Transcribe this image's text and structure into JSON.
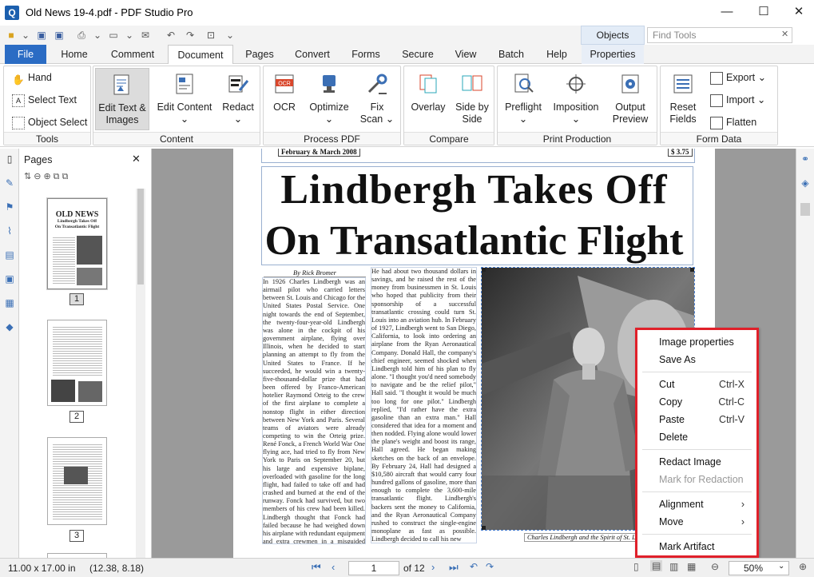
{
  "app": {
    "title": "Old News 19-4.pdf - PDF Studio Pro",
    "icon_letter": "Q",
    "window_buttons": [
      "—",
      "☐",
      "✕"
    ]
  },
  "quick_access": {
    "objects_tab": "Objects",
    "find_tools_placeholder": "Find Tools",
    "find_close": "✕"
  },
  "tabs": [
    {
      "label": "File"
    },
    {
      "label": "Home"
    },
    {
      "label": "Comment"
    },
    {
      "label": "Document"
    },
    {
      "label": "Pages"
    },
    {
      "label": "Convert"
    },
    {
      "label": "Forms"
    },
    {
      "label": "Secure"
    },
    {
      "label": "View"
    },
    {
      "label": "Batch"
    },
    {
      "label": "Help"
    },
    {
      "label": "Properties"
    }
  ],
  "ribbon": {
    "tools": {
      "label": "Tools",
      "hand": "Hand",
      "select_text": "Select Text",
      "object_select": "Object Select"
    },
    "content": {
      "label": "Content",
      "edit_text": "Edit Text &",
      "edit_text2": "Images",
      "edit_content": "Edit Content",
      "redact": "Redact"
    },
    "process": {
      "label": "Process PDF",
      "ocr": "OCR",
      "optimize": "Optimize",
      "fix": "Fix",
      "fix2": "Scan"
    },
    "compare": {
      "label": "Compare",
      "overlay": "Overlay",
      "side": "Side by",
      "side2": "Side"
    },
    "print": {
      "label": "Print Production",
      "preflight": "Preflight",
      "imposition": "Imposition",
      "output": "Output",
      "output2": "Preview"
    },
    "form": {
      "label": "Form Data",
      "reset": "Reset",
      "reset2": "Fields",
      "export": "Export",
      "import": "Import",
      "flatten": "Flatten"
    }
  },
  "pages_panel": {
    "title": "Pages",
    "close": "✕",
    "page_numbers": [
      "1",
      "2",
      "3"
    ],
    "thumb1_title": "OLD NEWS",
    "thumb1_sub1": "Lindbergh Takes Off",
    "thumb1_sub2": "On Transatlantic Flight"
  },
  "document": {
    "date": "February & March 2008",
    "price": "$ 3.75",
    "headline1": "Lindbergh Takes Off",
    "headline2": "On Transatlantic Flight",
    "byline": "By Rick Bromer",
    "col1": "In 1926 Charles Lindbergh was an airmail pilot who carried letters between St. Louis and Chicago for the United States Postal Service. One night towards the end of September, the twenty-four-year-old Lindbergh was alone in the cockpit of his government airplane, flying over Illinois, when he decided to start planning an attempt to fly from the United States to France. If he succeeded, he would win a twenty-five-thousand-dollar prize that had been offered by Franco-American hotelier Raymond Orteig to the crew of the first airplane to complete a nonstop flight in either direction between New York and Paris. Several teams of aviators were already competing to win the Orteig prize. René Fonck, a French World War One flying ace, had tried to fly from New York to Paris on September 20, but his large and expensive biplane, overloaded with gasoline for the long flight, had failed to take off and had crashed and burned at the end of the runway. Fonck had survived, but two members of his crew had been killed. Lindbergh thought that Fonck had failed because he had weighed down his airplane with redundant equipment and extra crewmen in a misguided attempt to make his flight safer. Fonck's plane had two sets of",
    "col2": "He had about two thousand dollars in savings, and he raised the rest of the money from businessmen in St. Louis who hoped that publicity from their sponsorship of a successful transatlantic crossing could turn St. Louis into an aviation hub. In February of 1927, Lindbergh went to San Diego, California, to look into ordering an airplane from the Ryan Aeronautical Company. Donald Hall, the company's chief engineer, seemed shocked when Lindbergh told him of his plan to fly alone. \"I thought you'd need somebody to navigate and be the relief pilot,\" Hall said. \"I thought it would be much too long for one pilot.\" Lindbergh replied, \"I'd rather have the extra gasoline than an extra man.\" Hall considered that idea for a moment and then nodded. Flying alone would lower the plane's weight and boost its range, Hall agreed. He began making sketches on the back of an envelope. By February 24, Hall had designed a $10,580 aircraft that would carry four hundred gallons of gasoline, more than enough to complete the 3,600-mile transatlantic flight. Lindbergh's backers sent the money to California, and the Ryan Aeronautical Company rushed to construct the single-engine monoplane as fast as possible. Lindbergh decided to call his new",
    "caption": "Charles Lindbergh and the Spirit of St. Louis"
  },
  "context_menu": {
    "image_properties": "Image properties",
    "save_as": "Save As",
    "cut": "Cut",
    "cut_key": "Ctrl-X",
    "copy": "Copy",
    "copy_key": "Ctrl-C",
    "paste": "Paste",
    "paste_key": "Ctrl-V",
    "delete": "Delete",
    "redact_image": "Redact Image",
    "mark_for_redaction": "Mark for Redaction",
    "alignment": "Alignment",
    "move": "Move",
    "mark_artifact": "Mark Artifact"
  },
  "status": {
    "page_size": "11.00 x 17.00 in",
    "coords": "(12.38, 8.18)",
    "current_page": "1",
    "of_pages": "of 12",
    "zoom": "50%"
  }
}
